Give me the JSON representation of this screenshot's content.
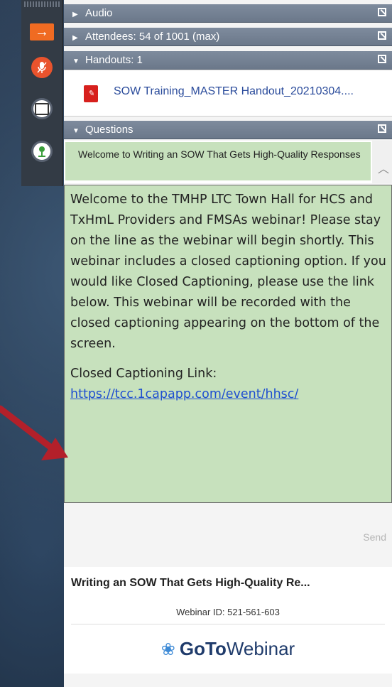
{
  "sections": {
    "audio": "Audio",
    "attendees": "Attendees: 54 of 1001 (max)",
    "handouts": "Handouts: 1",
    "questions": "Questions"
  },
  "handout": {
    "filename": "SOW Training_MASTER Handout_20210304...."
  },
  "question_item": "Welcome to Writing an SOW That Gets High-Quality Responses",
  "message": {
    "body": "Welcome to the TMHP LTC Town Hall for HCS and TxHmL Providers and FMSAs webinar! Please stay on the line as the webinar will begin shortly. This webinar includes a closed captioning option. If you would like Closed Captioning, please use the link below. This webinar will be recorded with the closed captioning appearing on the bottom of the screen.",
    "cc_label": "Closed Captioning Link:",
    "cc_link": "https://tcc.1capapp.com/event/hhsc/"
  },
  "send_label": "Send",
  "footer": {
    "webinar_title": "Writing an SOW That Gets High-Quality Re...",
    "webinar_id": "Webinar ID: 521-561-603",
    "brand_bold": "GoTo",
    "brand_light": "Webinar"
  },
  "colors": {
    "orange": "#f06b22",
    "green_bg": "#c7e1bd",
    "header": "#7e8b9d",
    "link": "#1f4fd0",
    "arrow": "#b3202a"
  }
}
